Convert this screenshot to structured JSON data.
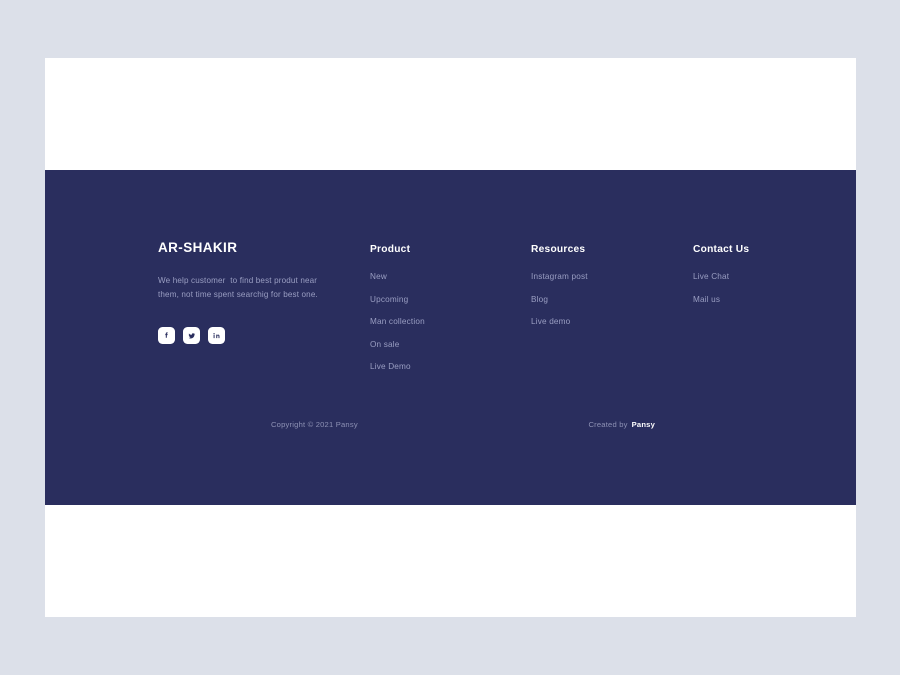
{
  "colors": {
    "page_background": "#dce0e9",
    "card_background": "#ffffff",
    "footer_background": "#2a2e5e",
    "heading_text": "#ffffff",
    "muted_text": "#9a9ec2",
    "bottom_text": "#8d91b4",
    "social_button_background": "#ffffff"
  },
  "footer": {
    "brand": {
      "title": "AR-SHAKIR",
      "description": "We help customer  to find best produt near them, not time spent searchig for best one.",
      "socials": [
        {
          "name": "facebook",
          "icon": "facebook-icon"
        },
        {
          "name": "twitter",
          "icon": "twitter-icon"
        },
        {
          "name": "linkedin",
          "icon": "linkedin-icon"
        }
      ]
    },
    "columns": [
      {
        "heading": "Product",
        "links": [
          "New",
          "Upcoming",
          "Man collection",
          "On sale",
          "Live Demo"
        ]
      },
      {
        "heading": "Resources",
        "links": [
          "Instagram post",
          "Blog",
          "Live demo"
        ]
      },
      {
        "heading": "Contact Us",
        "links": [
          "Live Chat",
          "Mail us"
        ]
      }
    ],
    "bottom": {
      "copyright": "Copyright © 2021 Pansy",
      "credit_prefix": "Created by",
      "credit_brand": "Pansy"
    }
  }
}
